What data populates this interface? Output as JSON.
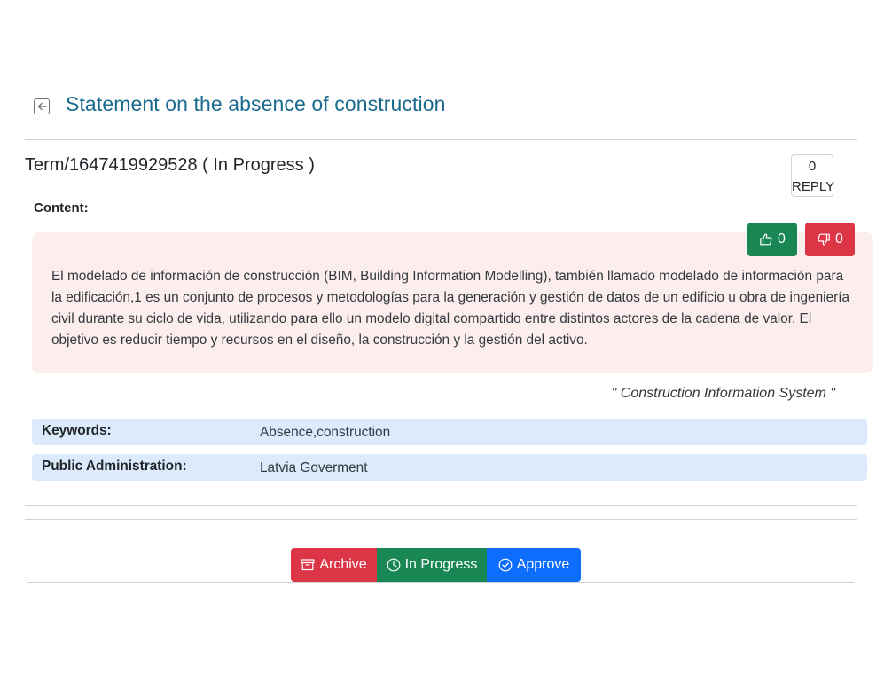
{
  "header": {
    "title": "Statement on the absence of construction"
  },
  "term": {
    "id_status": "Term/1647419929528 ( In Progress )"
  },
  "reply": {
    "count": "0",
    "label": "REPLY"
  },
  "content": {
    "label": "Content:",
    "text": "El modelado de información de construcción (BIM, Building Information Modelling), también llamado modelado de información para la edificación,1 es un conjunto de procesos y metodologías para la generación y gestión de datos de un edificio u obra de ingeniería civil durante su ciclo de vida, utilizando para ello un modelo digital compartido entre distintos actores de la cadena de valor. El objetivo es reducir tiempo y recursos en el diseño, la construcción y la gestión del activo.",
    "source": "\" Construction Information System \""
  },
  "votes": {
    "up": "0",
    "down": "0"
  },
  "details": [
    {
      "label": "Keywords:",
      "value": "Absence,construction"
    },
    {
      "label": "Public Administration:",
      "value": "Latvia Goverment"
    }
  ],
  "actions": {
    "archive": "Archive",
    "in_progress": "In Progress",
    "approve": "Approve"
  },
  "colors": {
    "title": "#1a6a8e",
    "content_bg": "#fdeeee",
    "detail_bg": "#dcebfb",
    "success": "#198754",
    "danger": "#dc3545",
    "primary": "#0d6efd"
  }
}
